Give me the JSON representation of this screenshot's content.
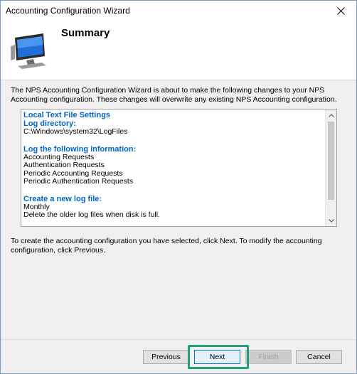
{
  "window": {
    "title": "Accounting Configuration Wizard"
  },
  "header": {
    "heading": "Summary",
    "icon": "computer-monitor-icon"
  },
  "intro_text": "The NPS Accounting Configuration Wizard is about to make the following changes to your NPS Accounting configuration. These changes will overwrite any existing NPS Accounting configuration.",
  "summary": {
    "section1_title": "Local Text File Settings",
    "log_dir_label": "Log directory:",
    "log_dir_value": "C:\\Windows\\system32\\LogFiles",
    "log_info_label": "Log the following information:",
    "log_items": [
      "Accounting Requests",
      "Authentication Requests",
      "Periodic Accounting Requests",
      "Periodic Authentication Requests"
    ],
    "new_log_label": "Create a new log file:",
    "new_log_items": [
      "Monthly",
      "Delete the older log files when disk is full."
    ]
  },
  "footer_text": "To create the accounting configuration you have selected, click Next. To modify the accounting configuration, click Previous.",
  "buttons": {
    "previous": "Previous",
    "next": "Next",
    "finish": "Finish",
    "cancel": "Cancel"
  },
  "colors": {
    "section_title": "#0066cc",
    "highlight": "#22a07a",
    "default_button_border": "#0078d7"
  }
}
